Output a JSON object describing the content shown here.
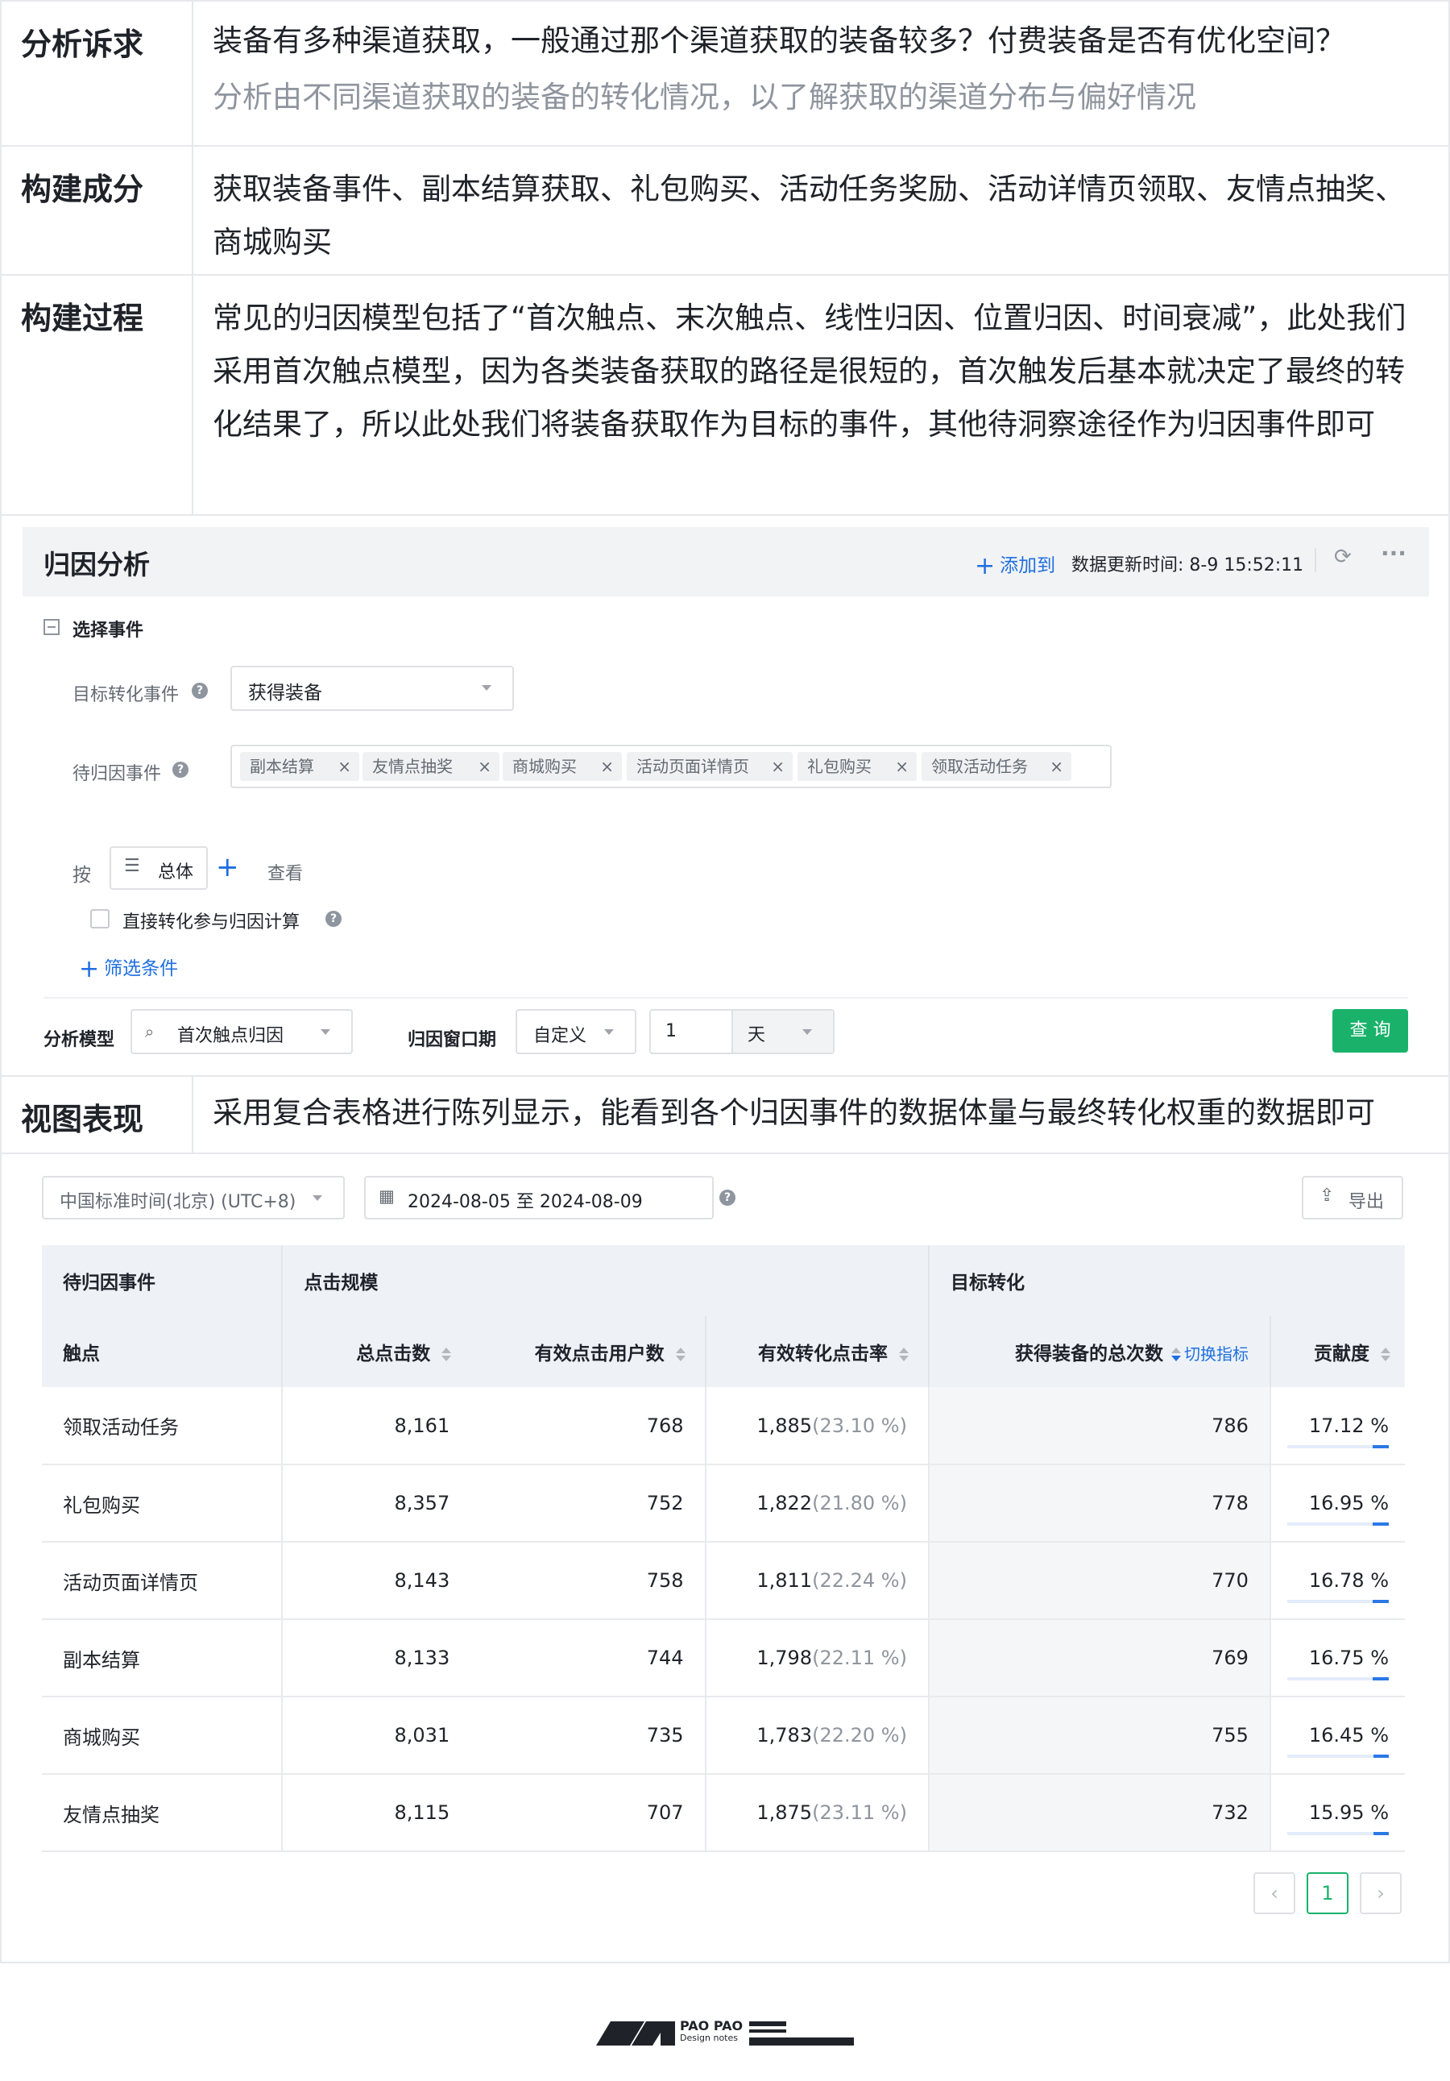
{
  "sections": {
    "appeal": {
      "label": "分析诉求",
      "line1": "装备有多种渠道获取，一般通过那个渠道获取的装备较多？付费装备是否有优化空间？",
      "line2": "分析由不同渠道获取的装备的转化情况，以了解获取的渠道分布与偏好情况"
    },
    "components": {
      "label": "构建成分",
      "text": "获取装备事件、副本结算获取、礼包购买、活动任务奖励、活动详情页领取、友情点抽奖、商城购买"
    },
    "process": {
      "label": "构建过程",
      "text": "常见的归因模型包括了“首次触点、末次触点、线性归因、位置归因、时间衰减”，此处我们采用首次触点模型，因为各类装备获取的路径是很短的，首次触发后基本就决定了最终的转化结果了，所以此处我们将装备获取作为目标的事件，其他待洞察途径作为归因事件即可"
    },
    "view": {
      "label": "视图表现",
      "text": "采用复合表格进行陈列显示，能看到各个归因事件的数据体量与最终转化权重的数据即可"
    }
  },
  "panel": {
    "title": "归因分析",
    "add_to": "添加到",
    "update_time": "数据更新时间: 8-9 15:52:11",
    "select_event": "选择事件",
    "target_event_label": "目标转化事件",
    "target_event_value": "获得装备",
    "attr_event_label": "待归因事件",
    "attr_tags": [
      "副本结算",
      "友情点抽奖",
      "商城购买",
      "活动页面详情页",
      "礼包购买",
      "领取活动任务"
    ],
    "by_label": "按",
    "group_value": "总体",
    "view_label": "查看",
    "direct_conv_label": "直接转化参与归因计算",
    "filter_label": "筛选条件",
    "model_label": "分析模型",
    "model_value": "首次触点归因",
    "window_label": "归因窗口期",
    "window_type": "自定义",
    "window_num": "1",
    "window_unit": "天",
    "query_button": "查 询"
  },
  "toolbar": {
    "timezone": "中国标准时间(北京) (UTC+8)",
    "date_range": "2024-08-05 至 2024-08-09",
    "export_label": "导出"
  },
  "table": {
    "group_headers": {
      "attr": "待归因事件",
      "clicks": "点击规模",
      "target": "目标转化"
    },
    "col_headers": {
      "touch": "触点",
      "total_clicks": "总点击数",
      "valid_users": "有效点击用户数",
      "conv_rate": "有效转化点击率",
      "total_get": "获得装备的总次数",
      "switch": "切换指标",
      "contribution": "贡献度"
    },
    "rows": [
      {
        "name": "领取活动任务",
        "total": "8,161",
        "users": "768",
        "conv": "1,885",
        "conv_pct": "(23.10 %)",
        "get": "786",
        "contrib": "17.12 %"
      },
      {
        "name": "礼包购买",
        "total": "8,357",
        "users": "752",
        "conv": "1,822",
        "conv_pct": "(21.80 %)",
        "get": "778",
        "contrib": "16.95 %"
      },
      {
        "name": "活动页面详情页",
        "total": "8,143",
        "users": "758",
        "conv": "1,811",
        "conv_pct": "(22.24 %)",
        "get": "770",
        "contrib": "16.78 %"
      },
      {
        "name": "副本结算",
        "total": "8,133",
        "users": "744",
        "conv": "1,798",
        "conv_pct": "(22.11 %)",
        "get": "769",
        "contrib": "16.75 %"
      },
      {
        "name": "商城购买",
        "total": "8,031",
        "users": "735",
        "conv": "1,783",
        "conv_pct": "(22.20 %)",
        "get": "755",
        "contrib": "16.45 %"
      },
      {
        "name": "友情点抽奖",
        "total": "8,115",
        "users": "707",
        "conv": "1,875",
        "conv_pct": "(23.11 %)",
        "get": "732",
        "contrib": "15.95 %"
      }
    ]
  },
  "pagination": {
    "prev": "‹",
    "current": "1",
    "next": "›"
  },
  "footer": {
    "brand": "PAO PAO",
    "tagline": "Design notes"
  },
  "colors": {
    "accent": "#1f6fe0",
    "query_button": "#1ab26b",
    "header_bg": "#eef2f7"
  }
}
